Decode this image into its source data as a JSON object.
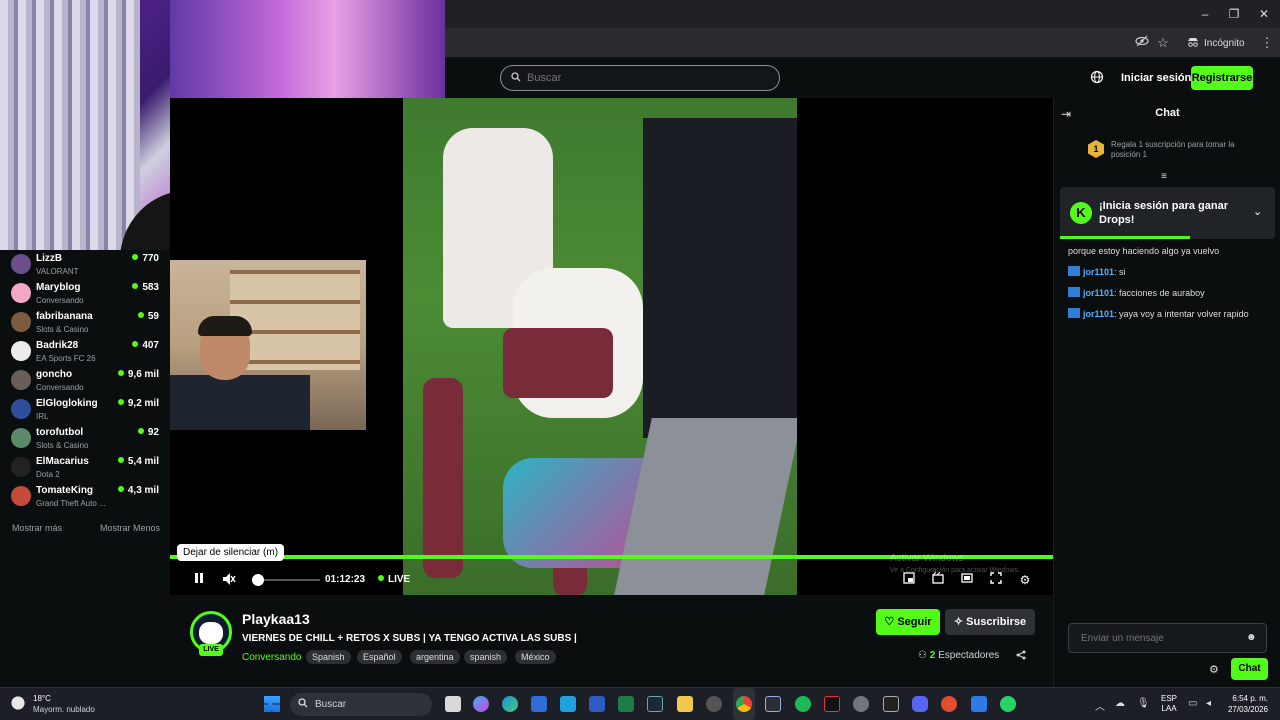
{
  "browser": {
    "incognito_label": "Incógnito",
    "window_controls": [
      "–",
      "❐",
      "✕"
    ]
  },
  "header": {
    "search_placeholder": "Buscar",
    "login_label": "Iniciar sesión",
    "register_label": "Registrarse"
  },
  "sidebar": {
    "channels": [
      {
        "name": "LizzB",
        "category": "VALORANT",
        "viewers": "770",
        "color": "#6b4d8a"
      },
      {
        "name": "Maryblog",
        "category": "Conversando",
        "viewers": "583",
        "color": "#f2a7c6"
      },
      {
        "name": "fabribanana",
        "category": "Slots & Casino",
        "viewers": "59",
        "color": "#7c5b3e"
      },
      {
        "name": "Badrik28",
        "category": "EA Sports FC 26",
        "viewers": "407",
        "color": "#ececec"
      },
      {
        "name": "goncho",
        "category": "Conversando",
        "viewers": "9,6 mil",
        "color": "#6a5e58"
      },
      {
        "name": "ElGlogloking",
        "category": "IRL",
        "viewers": "9,2 mil",
        "color": "#2f4e9a"
      },
      {
        "name": "torofutbol",
        "category": "Slots & Casino",
        "viewers": "92",
        "color": "#5a8a6a"
      },
      {
        "name": "ElMacarius",
        "category": "Dota 2",
        "viewers": "5,4 mil",
        "color": "#222222"
      },
      {
        "name": "TomateKing",
        "category": "Grand Theft Auto ...",
        "viewers": "4,3 mil",
        "color": "#c44a3a"
      }
    ],
    "show_more": "Mostrar más",
    "show_less": "Mostrar Menos"
  },
  "player": {
    "tooltip": "Dejar de silenciar (m)",
    "timecode": "01:12:23",
    "live": "LIVE",
    "watermark_title": "Activar Windows",
    "watermark_sub": "Ve a Configuración para activar Windows."
  },
  "stream": {
    "streamer": "Playkaa13",
    "live_badge": "LIVE",
    "title": "VIERNES DE CHILL  + RETOS X SUBS | YA TENGO ACTIVA LAS SUBS  |",
    "category": "Conversando",
    "tags": [
      "Spanish",
      "Español",
      "argentina",
      "spanish",
      "México"
    ],
    "follow_label": "Seguir",
    "subscribe_label": "Suscribirse",
    "viewers_count": "2",
    "viewers_label": "Espectadores"
  },
  "chat": {
    "title": "Chat",
    "gift_rank": "1",
    "gift_text": "Regala 1 suscripción para tomar la posición 1",
    "drops_text": "¡Inicia sesión para ganar Drops!",
    "partial_message": "porque estoy haciendo algo ya vuelvo",
    "messages": [
      {
        "user": "jor1101",
        "text": ": si"
      },
      {
        "user": "jor1101",
        "text": ": facciones de auraboy"
      },
      {
        "user": "jor1101",
        "text": ": yaya voy a intentar volver rapido"
      }
    ],
    "input_placeholder": "Enviar un mensaje",
    "send_label": "Chat"
  },
  "taskbar": {
    "weather_temp": "18°C",
    "weather_desc": "Mayorm. nublado",
    "search_label": "Buscar",
    "lang_line1": "ESP",
    "lang_line2": "LAA",
    "time": "6:54 p. m.",
    "date": "27/03/2026"
  },
  "colors": {
    "accent": "#53fc18",
    "background": "#0b0e0f",
    "chat_user": "#4fb1ff"
  }
}
